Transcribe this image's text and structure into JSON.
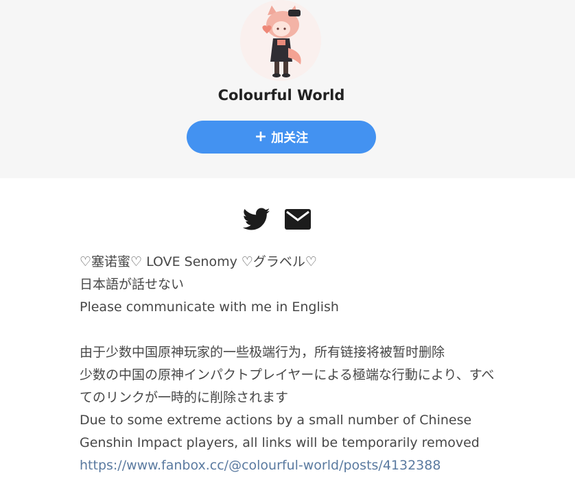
{
  "profile": {
    "name": "Colourful World",
    "avatar_icon": "avatar-image"
  },
  "follow_button": {
    "plus": "+",
    "label": "加关注",
    "color": "#4392f1"
  },
  "social": {
    "twitter_icon": "twitter-icon",
    "mail_icon": "mail-icon"
  },
  "bio": {
    "line1": "♡塞诺蜜♡ LOVE Senomy ♡グラベル♡",
    "line2": "日本語が話せない",
    "line3": "Please communicate with me in English",
    "line4": "由于少数中国原神玩家的一些极端行为，所有链接将被暂时删除",
    "line5": "少数の中国の原神インパクトプレイヤーによる極端な行動により、すべてのリンクが一時的に削除されます",
    "line6": "Due to some extreme actions by a small number of Chinese Genshin Impact players, all links will be temporarily removed",
    "link": "https://www.fanbox.cc/@colourful-world/posts/4132388"
  }
}
